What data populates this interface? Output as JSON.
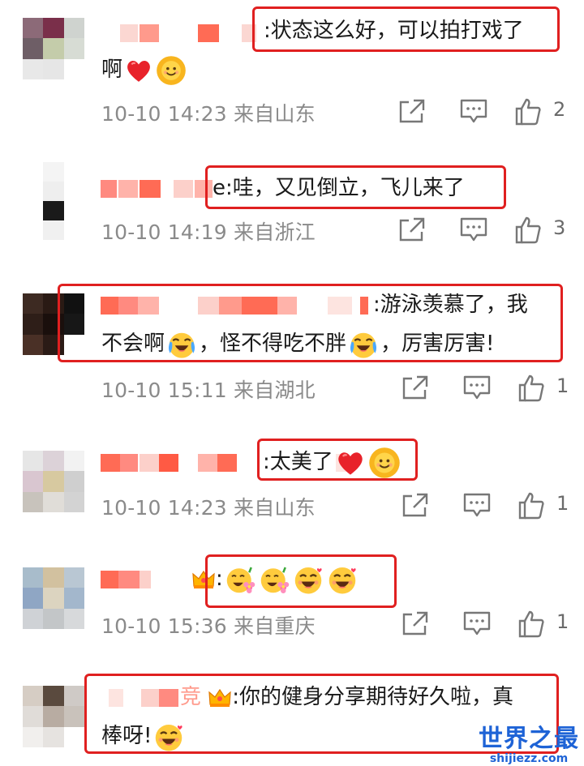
{
  "comments": [
    {
      "text_line1": ":状态这么好，可以拍打戏了",
      "text_line2": "啊",
      "time": "10-10 14:23",
      "location": "来自山东",
      "likes": "2",
      "emojis": [
        "heart-icon",
        "sun-smile-icon"
      ]
    },
    {
      "text_line1": "e:哇，又见倒立，飞儿来了",
      "time": "10-10 14:19",
      "location": "来自浙江",
      "likes": "3"
    },
    {
      "text_line1": ":游泳羡慕了，我",
      "text_line2a": "不会啊",
      "text_line2b": "，怪不得吃不胖",
      "text_line2c": "，厉害厉害!",
      "time": "10-10 15:11",
      "location": "来自湖北",
      "likes": "1",
      "emojis": [
        "laugh-cry-icon",
        "laugh-cry-icon"
      ]
    },
    {
      "text_line1": ":太美了",
      "time": "10-10 14:23",
      "location": "来自山东",
      "likes": "1",
      "emojis": [
        "heart-icon",
        "sun-smile-icon"
      ]
    },
    {
      "text_line1": ":",
      "time": "10-10 15:36",
      "location": "来自重庆",
      "likes": "1",
      "emojis": [
        "crown-icon",
        "flower-face-icon",
        "flower-face-icon",
        "love-face-icon",
        "love-face-icon"
      ]
    },
    {
      "text_line1": "竞",
      "text_line1b": ":你的健身分享期待好久啦，真",
      "text_line2": "棒呀!",
      "emojis": [
        "crown-icon",
        "love-face-icon"
      ]
    }
  ],
  "watermark": {
    "title": "世界之最",
    "subtitle": "shijiezz.com"
  },
  "colors": {
    "highlight": "#e02020",
    "meta_text": "#8a8a8a",
    "watermark": "#1e63d6"
  }
}
